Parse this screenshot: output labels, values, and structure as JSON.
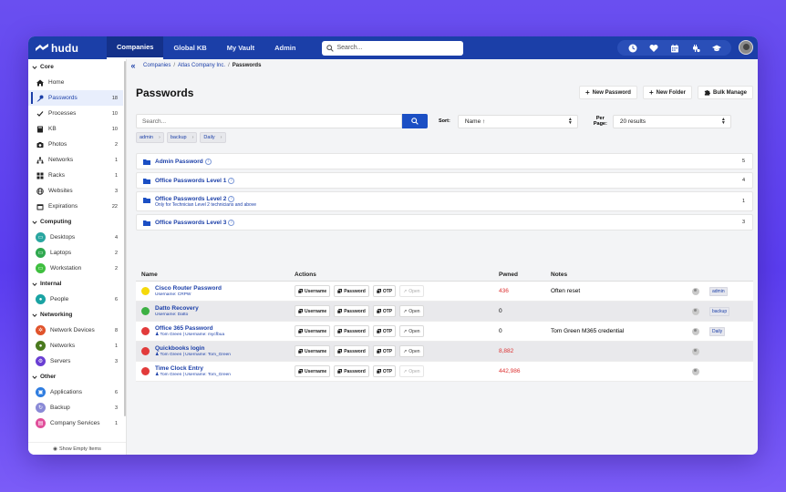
{
  "app": {
    "logo_text": "hudu",
    "nav": [
      "Companies",
      "Global KB",
      "My Vault",
      "Admin"
    ],
    "search_placeholder": "Search..."
  },
  "topbar_icons": [
    "clock-icon",
    "heart-icon",
    "calendar-icon",
    "plug-icon",
    "graduation-cap-icon"
  ],
  "sidebar": {
    "sections": [
      {
        "label": "Core",
        "items": [
          {
            "label": "Home",
            "count": "",
            "icon": "home-icon",
            "active": false
          },
          {
            "label": "Passwords",
            "count": "18",
            "icon": "key-icon",
            "active": true
          },
          {
            "label": "Processes",
            "count": "10",
            "icon": "check-icon",
            "active": false
          },
          {
            "label": "KB",
            "count": "10",
            "icon": "book-icon",
            "active": false
          },
          {
            "label": "Photos",
            "count": "2",
            "icon": "camera-icon",
            "active": false
          },
          {
            "label": "Networks",
            "count": "1",
            "icon": "network-icon",
            "active": false
          },
          {
            "label": "Racks",
            "count": "1",
            "icon": "rack-icon",
            "active": false
          },
          {
            "label": "Websites",
            "count": "3",
            "icon": "globe-icon",
            "active": false
          },
          {
            "label": "Expirations",
            "count": "22",
            "icon": "calendar-icon",
            "active": false
          }
        ]
      },
      {
        "label": "Computing",
        "items": [
          {
            "label": "Desktops",
            "count": "4",
            "icon": "desktop-icon",
            "color": "#2aa6a0"
          },
          {
            "label": "Laptops",
            "count": "2",
            "icon": "laptop-icon",
            "color": "#2fa84f"
          },
          {
            "label": "Workstation",
            "count": "2",
            "icon": "workstation-icon",
            "color": "#3fbf3f"
          }
        ]
      },
      {
        "label": "Internal",
        "items": [
          {
            "label": "People",
            "count": "6",
            "icon": "person-icon",
            "color": "#1aa3a3"
          }
        ]
      },
      {
        "label": "Networking",
        "items": [
          {
            "label": "Network Devices",
            "count": "8",
            "icon": "network-device-icon",
            "color": "#e0532b"
          },
          {
            "label": "Networks",
            "count": "1",
            "icon": "network-icon",
            "color": "#4a7a1e"
          },
          {
            "label": "Servers",
            "count": "3",
            "icon": "server-icon",
            "color": "#6a3fd3"
          }
        ]
      },
      {
        "label": "Other",
        "items": [
          {
            "label": "Applications",
            "count": "6",
            "icon": "applications-icon",
            "color": "#2f7de0"
          },
          {
            "label": "Backup",
            "count": "3",
            "icon": "backup-icon",
            "color": "#8a8ad6"
          },
          {
            "label": "Company Services",
            "count": "1",
            "icon": "services-icon",
            "color": "#e04f9a"
          }
        ]
      }
    ],
    "footer": "Show Empty Items"
  },
  "breadcrumb": [
    "Companies",
    "Atlas Company Inc.",
    "Passwords"
  ],
  "page": {
    "title": "Passwords",
    "buttons": {
      "new_password": "New Password",
      "new_folder": "New Folder",
      "bulk_manage": "Bulk Manage"
    }
  },
  "filters": {
    "search_placeholder": "Search...",
    "sort_label": "Sort:",
    "sort_value": "Name ↑",
    "per_page_label_1": "Per",
    "per_page_label_2": "Page:",
    "per_page_value": "20 results",
    "tags": [
      "admin",
      "backup",
      "Daily"
    ]
  },
  "folders": [
    {
      "name": "Admin Password",
      "count": "5",
      "subtitle": ""
    },
    {
      "name": "Office Passwords Level 1",
      "count": "4",
      "subtitle": ""
    },
    {
      "name": "Office Passwords Level 2",
      "count": "1",
      "subtitle": "Only for Technician Level 2 technicians and above"
    },
    {
      "name": "Office Passwords Level 3",
      "count": "3",
      "subtitle": ""
    }
  ],
  "table": {
    "headers": {
      "name": "Name",
      "actions": "Actions",
      "pwned": "Pwned",
      "notes": "Notes"
    },
    "action_labels": {
      "username": "Username",
      "password": "Password",
      "otp": "OTP",
      "open": "Open"
    },
    "rows": [
      {
        "name": "Cisco Router Password",
        "sub": "Username: CRPW",
        "status_color": "#f5d90a",
        "pwned": "436",
        "pwned_red": true,
        "notes": "Often reset",
        "tag": "admin",
        "open_disabled": true
      },
      {
        "name": "Datto Recovery",
        "sub": "Username: Datto",
        "status_color": "#3cb043",
        "pwned": "0",
        "pwned_red": false,
        "notes": "",
        "tag": "backup",
        "open_disabled": false
      },
      {
        "name": "Office 365 Password",
        "sub": "Tom Green | Username: mycfbua",
        "status_color": "#e23b3b",
        "pwned": "0",
        "pwned_red": false,
        "notes": "Tom Green M365 credential",
        "tag": "Daily",
        "open_disabled": false
      },
      {
        "name": "Quickbooks login",
        "sub": "Tom Green | Username: Tom_Green",
        "status_color": "#e23b3b",
        "pwned": "8,882",
        "pwned_red": true,
        "notes": "",
        "tag": "",
        "open_disabled": false
      },
      {
        "name": "Time Clock Entry",
        "sub": "Tom Green | Username: Tom_Green",
        "status_color": "#e23b3b",
        "pwned": "442,986",
        "pwned_red": true,
        "notes": "",
        "tag": "",
        "open_disabled": true
      }
    ]
  },
  "colors": {
    "brand": "#1b3fa8",
    "accent": "#1b4fc4",
    "danger": "#d33"
  }
}
